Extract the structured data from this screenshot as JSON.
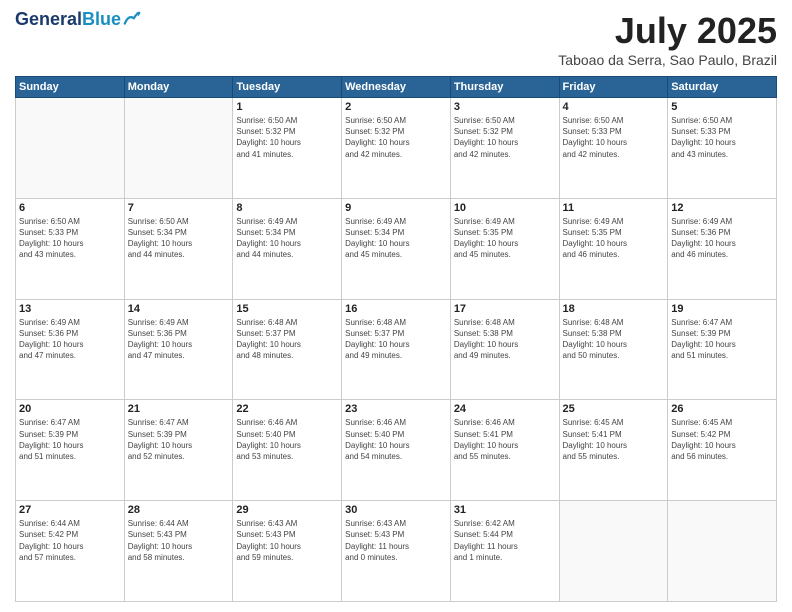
{
  "header": {
    "logo_line1": "General",
    "logo_line2": "Blue",
    "month": "July 2025",
    "location": "Taboao da Serra, Sao Paulo, Brazil"
  },
  "weekdays": [
    "Sunday",
    "Monday",
    "Tuesday",
    "Wednesday",
    "Thursday",
    "Friday",
    "Saturday"
  ],
  "weeks": [
    [
      {
        "day": "",
        "info": ""
      },
      {
        "day": "",
        "info": ""
      },
      {
        "day": "1",
        "info": "Sunrise: 6:50 AM\nSunset: 5:32 PM\nDaylight: 10 hours\nand 41 minutes."
      },
      {
        "day": "2",
        "info": "Sunrise: 6:50 AM\nSunset: 5:32 PM\nDaylight: 10 hours\nand 42 minutes."
      },
      {
        "day": "3",
        "info": "Sunrise: 6:50 AM\nSunset: 5:32 PM\nDaylight: 10 hours\nand 42 minutes."
      },
      {
        "day": "4",
        "info": "Sunrise: 6:50 AM\nSunset: 5:33 PM\nDaylight: 10 hours\nand 42 minutes."
      },
      {
        "day": "5",
        "info": "Sunrise: 6:50 AM\nSunset: 5:33 PM\nDaylight: 10 hours\nand 43 minutes."
      }
    ],
    [
      {
        "day": "6",
        "info": "Sunrise: 6:50 AM\nSunset: 5:33 PM\nDaylight: 10 hours\nand 43 minutes."
      },
      {
        "day": "7",
        "info": "Sunrise: 6:50 AM\nSunset: 5:34 PM\nDaylight: 10 hours\nand 44 minutes."
      },
      {
        "day": "8",
        "info": "Sunrise: 6:49 AM\nSunset: 5:34 PM\nDaylight: 10 hours\nand 44 minutes."
      },
      {
        "day": "9",
        "info": "Sunrise: 6:49 AM\nSunset: 5:34 PM\nDaylight: 10 hours\nand 45 minutes."
      },
      {
        "day": "10",
        "info": "Sunrise: 6:49 AM\nSunset: 5:35 PM\nDaylight: 10 hours\nand 45 minutes."
      },
      {
        "day": "11",
        "info": "Sunrise: 6:49 AM\nSunset: 5:35 PM\nDaylight: 10 hours\nand 46 minutes."
      },
      {
        "day": "12",
        "info": "Sunrise: 6:49 AM\nSunset: 5:36 PM\nDaylight: 10 hours\nand 46 minutes."
      }
    ],
    [
      {
        "day": "13",
        "info": "Sunrise: 6:49 AM\nSunset: 5:36 PM\nDaylight: 10 hours\nand 47 minutes."
      },
      {
        "day": "14",
        "info": "Sunrise: 6:49 AM\nSunset: 5:36 PM\nDaylight: 10 hours\nand 47 minutes."
      },
      {
        "day": "15",
        "info": "Sunrise: 6:48 AM\nSunset: 5:37 PM\nDaylight: 10 hours\nand 48 minutes."
      },
      {
        "day": "16",
        "info": "Sunrise: 6:48 AM\nSunset: 5:37 PM\nDaylight: 10 hours\nand 49 minutes."
      },
      {
        "day": "17",
        "info": "Sunrise: 6:48 AM\nSunset: 5:38 PM\nDaylight: 10 hours\nand 49 minutes."
      },
      {
        "day": "18",
        "info": "Sunrise: 6:48 AM\nSunset: 5:38 PM\nDaylight: 10 hours\nand 50 minutes."
      },
      {
        "day": "19",
        "info": "Sunrise: 6:47 AM\nSunset: 5:39 PM\nDaylight: 10 hours\nand 51 minutes."
      }
    ],
    [
      {
        "day": "20",
        "info": "Sunrise: 6:47 AM\nSunset: 5:39 PM\nDaylight: 10 hours\nand 51 minutes."
      },
      {
        "day": "21",
        "info": "Sunrise: 6:47 AM\nSunset: 5:39 PM\nDaylight: 10 hours\nand 52 minutes."
      },
      {
        "day": "22",
        "info": "Sunrise: 6:46 AM\nSunset: 5:40 PM\nDaylight: 10 hours\nand 53 minutes."
      },
      {
        "day": "23",
        "info": "Sunrise: 6:46 AM\nSunset: 5:40 PM\nDaylight: 10 hours\nand 54 minutes."
      },
      {
        "day": "24",
        "info": "Sunrise: 6:46 AM\nSunset: 5:41 PM\nDaylight: 10 hours\nand 55 minutes."
      },
      {
        "day": "25",
        "info": "Sunrise: 6:45 AM\nSunset: 5:41 PM\nDaylight: 10 hours\nand 55 minutes."
      },
      {
        "day": "26",
        "info": "Sunrise: 6:45 AM\nSunset: 5:42 PM\nDaylight: 10 hours\nand 56 minutes."
      }
    ],
    [
      {
        "day": "27",
        "info": "Sunrise: 6:44 AM\nSunset: 5:42 PM\nDaylight: 10 hours\nand 57 minutes."
      },
      {
        "day": "28",
        "info": "Sunrise: 6:44 AM\nSunset: 5:43 PM\nDaylight: 10 hours\nand 58 minutes."
      },
      {
        "day": "29",
        "info": "Sunrise: 6:43 AM\nSunset: 5:43 PM\nDaylight: 10 hours\nand 59 minutes."
      },
      {
        "day": "30",
        "info": "Sunrise: 6:43 AM\nSunset: 5:43 PM\nDaylight: 11 hours\nand 0 minutes."
      },
      {
        "day": "31",
        "info": "Sunrise: 6:42 AM\nSunset: 5:44 PM\nDaylight: 11 hours\nand 1 minute."
      },
      {
        "day": "",
        "info": ""
      },
      {
        "day": "",
        "info": ""
      }
    ]
  ]
}
